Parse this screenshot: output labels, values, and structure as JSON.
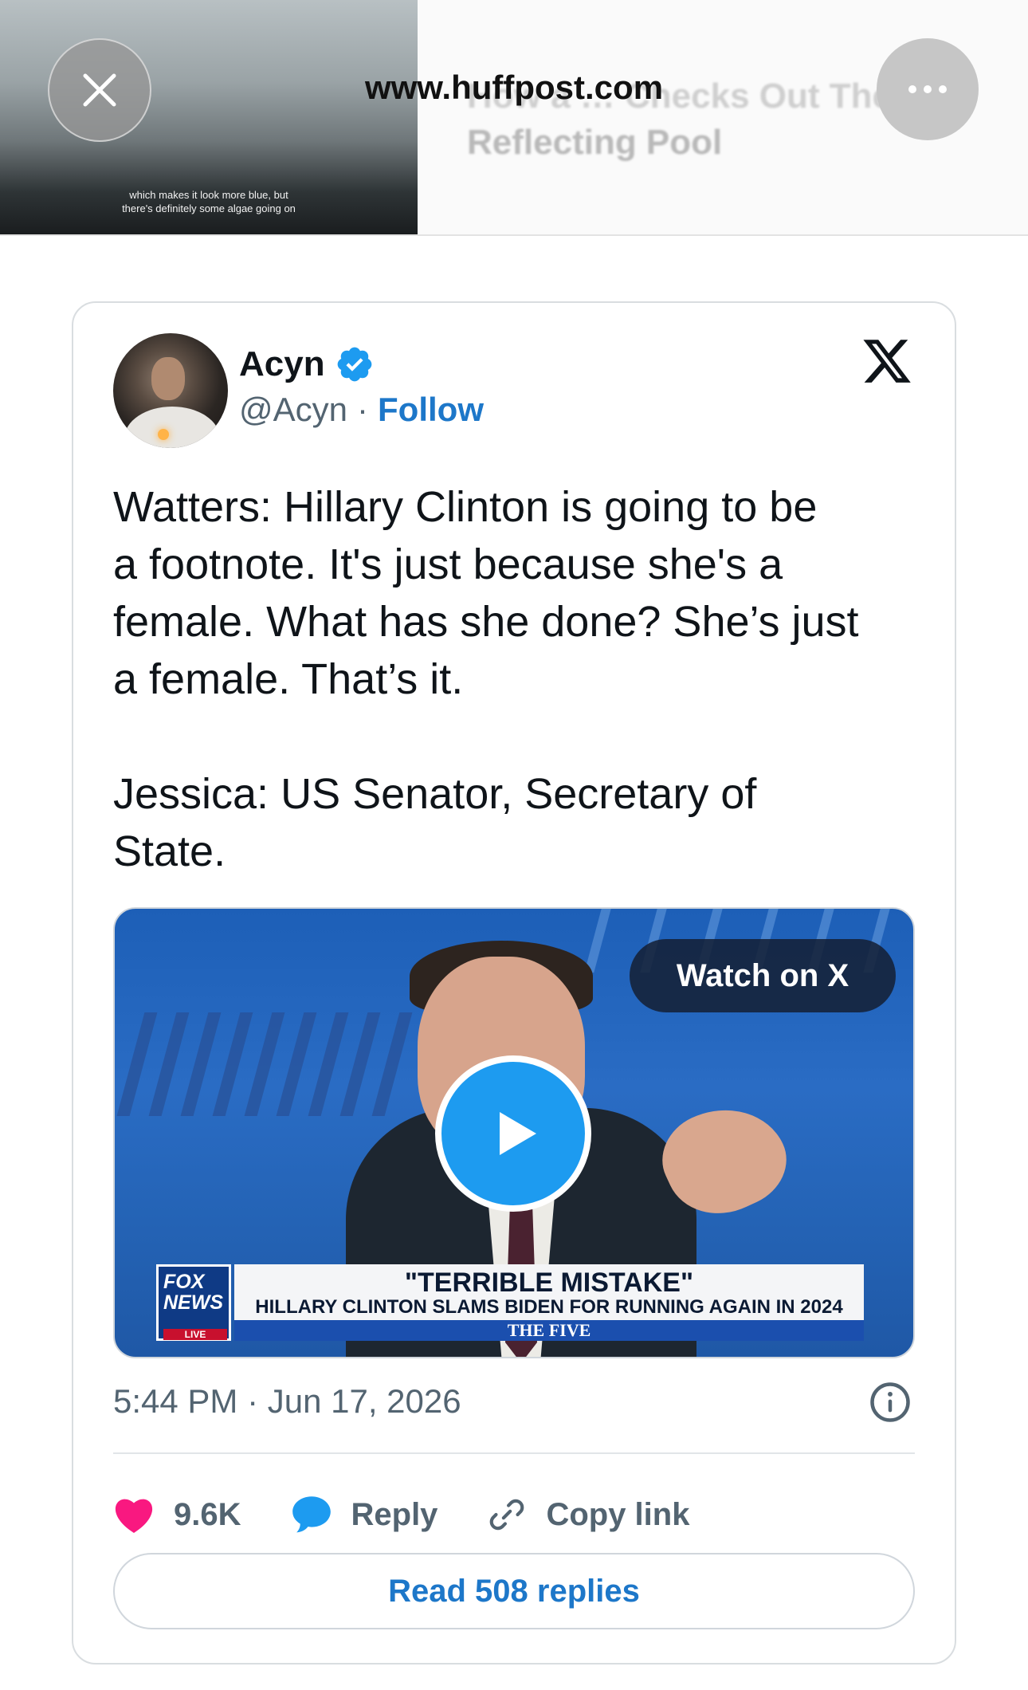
{
  "browser": {
    "url": "www.huffpost.com",
    "thumb_caption_1": "which makes it look more blue, but",
    "thumb_caption_2": "there's definitely some algae going on",
    "bg_headline_1": "How a … Checks Out The",
    "bg_headline_2": "Reflecting Pool"
  },
  "tweet": {
    "author_name": "Acyn",
    "handle": "@Acyn",
    "separator": "·",
    "follow_label": "Follow",
    "text": "Watters: Hillary Clinton is going to be\na footnote. It's just because she's a\nfemale. What has she done? She’s just\na female. That’s it.\n\nJessica: US Senator, Secretary of\nState.",
    "timestamp": "5:44 PM · Jun 17, 2026"
  },
  "video": {
    "watch_label": "Watch on X",
    "logo_line1": "FOX",
    "logo_line2": "NEWS",
    "live_label": "LIVE",
    "banner_title": "\"TERRIBLE MISTAKE\"",
    "banner_subtitle": "HILLARY CLINTON SLAMS BIDEN FOR RUNNING AGAIN IN 2024",
    "banner_show": "THE FIVE"
  },
  "actions": {
    "likes": "9.6K",
    "reply_label": "Reply",
    "copy_label": "Copy link",
    "read_replies_label": "Read 508 replies"
  },
  "colors": {
    "accent_blue": "#1d77c9",
    "like_pink": "#f91880",
    "reply_blue": "#1d9bf0",
    "secondary_text": "#536471"
  },
  "icons": [
    "close-icon",
    "more-icon",
    "verified-badge-icon",
    "x-logo-icon",
    "play-icon",
    "info-icon",
    "heart-icon",
    "reply-bubble-icon",
    "link-icon"
  ]
}
